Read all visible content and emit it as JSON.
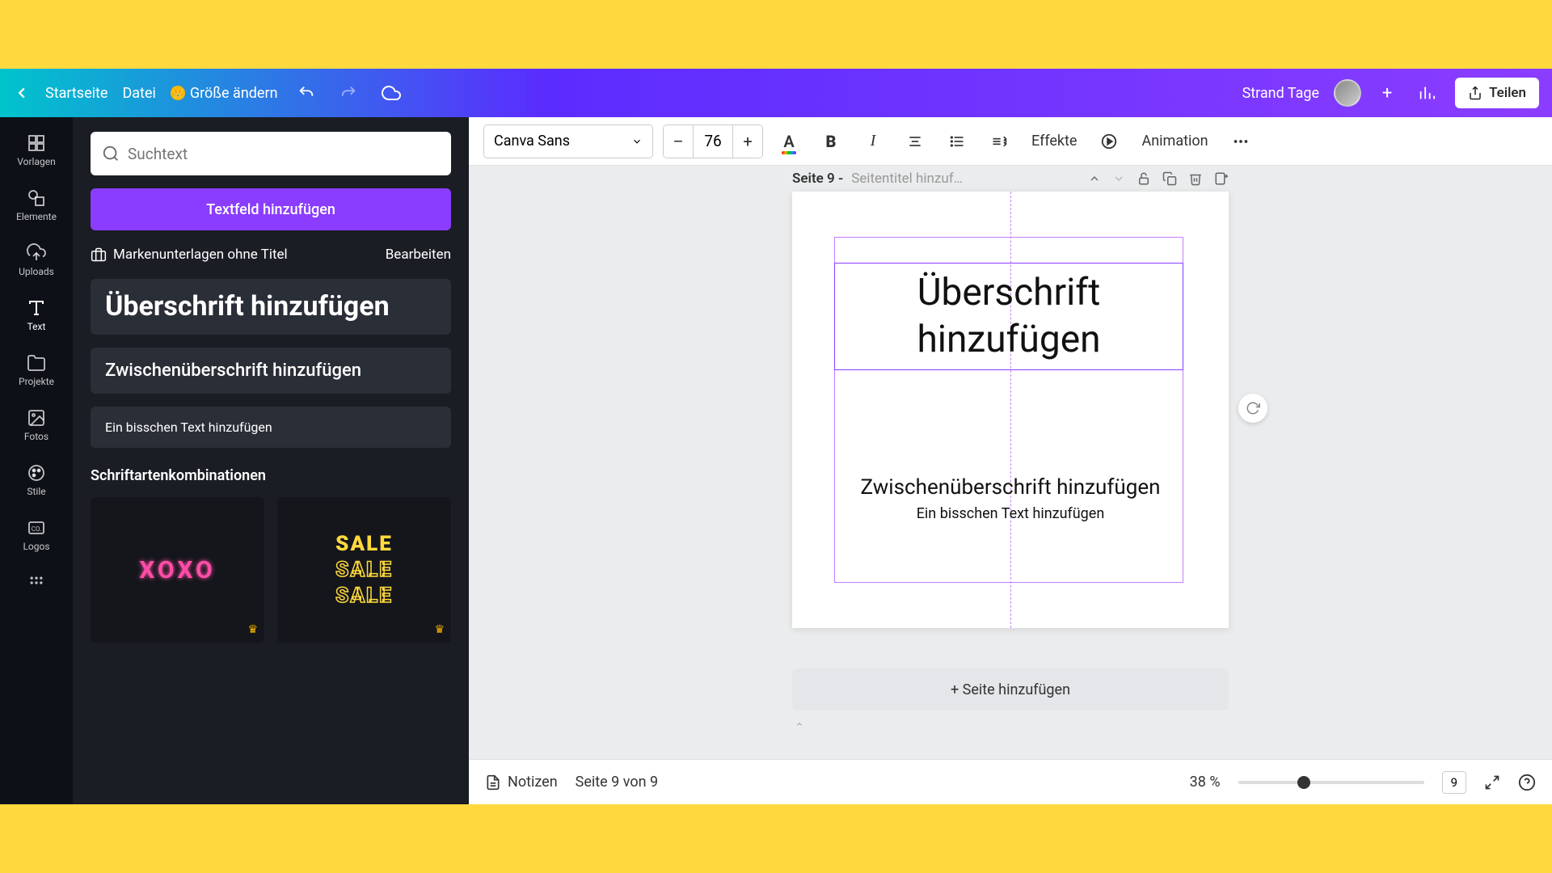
{
  "topbar": {
    "home": "Startseite",
    "file": "Datei",
    "resize": "Größe ändern",
    "doc_title": "Strand Tage",
    "share": "Teilen"
  },
  "nav": {
    "templates": "Vorlagen",
    "elements": "Elemente",
    "uploads": "Uploads",
    "text": "Text",
    "projects": "Projekte",
    "photos": "Fotos",
    "styles": "Stile",
    "logos": "Logos"
  },
  "panel": {
    "search_placeholder": "Suchtext",
    "add_textbox": "Textfeld hinzufügen",
    "brand_kit": "Markenunterlagen ohne Titel",
    "edit": "Bearbeiten",
    "heading": "Überschrift hinzufügen",
    "subheading": "Zwischenüberschrift hinzufügen",
    "body": "Ein bisschen Text hinzufügen",
    "combos_title": "Schriftartenkombinationen",
    "combo1": "XOXO",
    "combo2": "SALE"
  },
  "context_toolbar": {
    "font_name": "Canva Sans",
    "font_size": "76",
    "effects": "Effekte",
    "animation": "Animation"
  },
  "page_header": {
    "page_label": "Seite 9 -",
    "title_placeholder": "Seitentitel hinzuf…"
  },
  "canvas": {
    "heading": "Überschrift hinzufügen",
    "subheading": "Zwischenüberschrift hinzufügen",
    "body": "Ein bisschen Text hinzufügen",
    "add_page": "+ Seite hinzufügen"
  },
  "bottombar": {
    "notes": "Notizen",
    "page_of": "Seite 9 von 9",
    "zoom": "38 %",
    "page_num": "9"
  }
}
